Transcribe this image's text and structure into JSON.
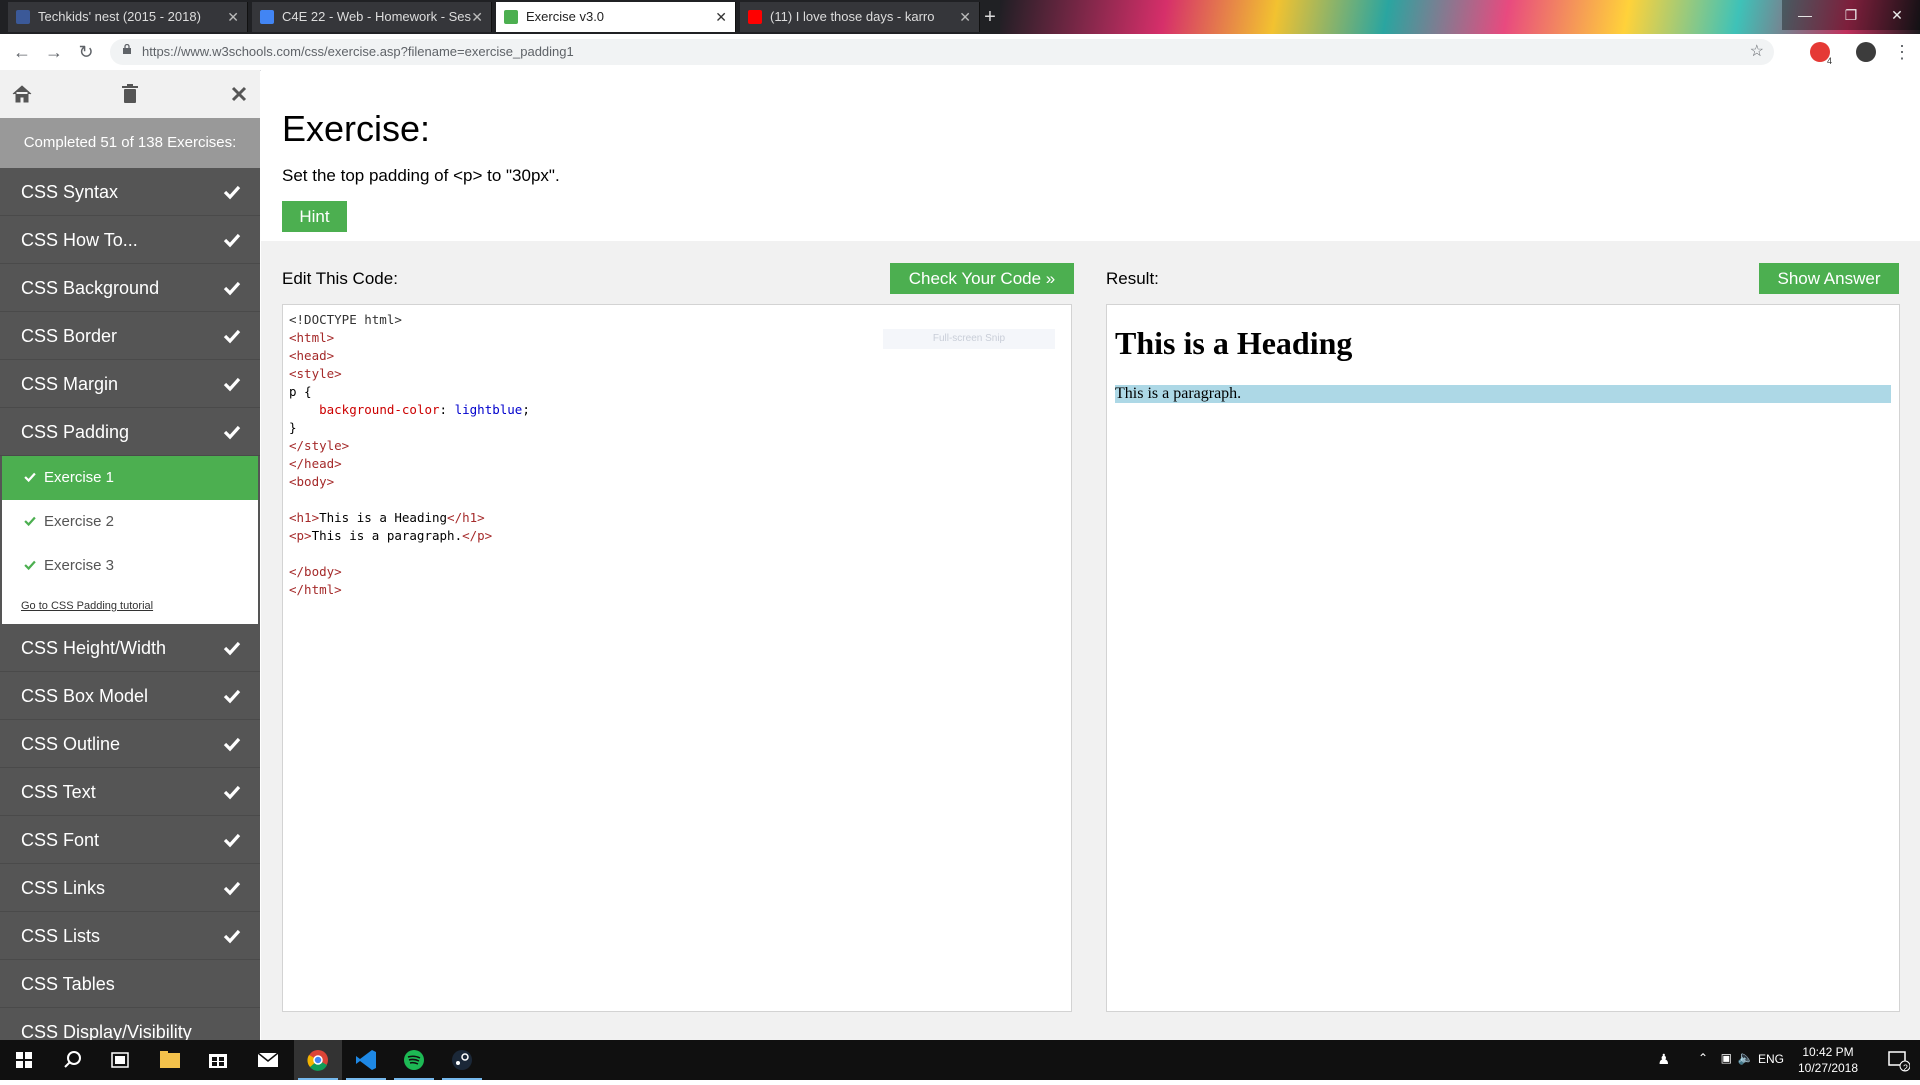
{
  "browser": {
    "tabs": [
      {
        "label": "Techkids' nest (2015 - 2018)",
        "favicon_color": "#3b5998",
        "active": false
      },
      {
        "label": "C4E 22 - Web - Homework - Ses",
        "favicon_color": "#4285f4",
        "active": false
      },
      {
        "label": "Exercise v3.0",
        "favicon_color": "#4CAF50",
        "active": true
      },
      {
        "label": "(11) I love those days - karro",
        "favicon_color": "#ff0000",
        "active": false
      }
    ],
    "new_tab": "+",
    "url": "https://www.w3schools.com/css/exercise.asp?filename=exercise_padding1",
    "window_controls": [
      "—",
      "❐",
      "✕"
    ],
    "extension_badge": "4"
  },
  "sidebar": {
    "progress": "Completed 51 of 138 Exercises:",
    "items_before": [
      {
        "label": "CSS Syntax",
        "done": true
      },
      {
        "label": "CSS How To...",
        "done": true
      },
      {
        "label": "CSS Background",
        "done": true
      },
      {
        "label": "CSS Border",
        "done": true
      },
      {
        "label": "CSS Margin",
        "done": true
      },
      {
        "label": "CSS Padding",
        "done": true
      }
    ],
    "exercises": [
      {
        "label": "Exercise 1",
        "active": true
      },
      {
        "label": "Exercise 2",
        "active": false
      },
      {
        "label": "Exercise 3",
        "active": false
      }
    ],
    "tutorial_link": "Go to CSS Padding tutorial",
    "items_after": [
      {
        "label": "CSS Height/Width",
        "done": true
      },
      {
        "label": "CSS Box Model",
        "done": true
      },
      {
        "label": "CSS Outline",
        "done": true
      },
      {
        "label": "CSS Text",
        "done": true
      },
      {
        "label": "CSS Font",
        "done": true
      },
      {
        "label": "CSS Links",
        "done": true
      },
      {
        "label": "CSS Lists",
        "done": true
      },
      {
        "label": "CSS Tables",
        "done": false
      },
      {
        "label": "CSS Display/Visibility",
        "done": false
      }
    ]
  },
  "exercise": {
    "title": "Exercise:",
    "description": "Set the top padding of <p> to \"30px\".",
    "hint": "Hint",
    "edit_label": "Edit This Code:",
    "check_button": "Check Your Code »",
    "result_label": "Result:",
    "answer_button": "Show Answer",
    "snip_overlay": "Full-screen Snip",
    "code": [
      "<!DOCTYPE html>",
      "<html>",
      "<head>",
      "<style>",
      "p {",
      "    background-color: lightblue;",
      "}",
      "</style>",
      "</head>",
      "<body>",
      "",
      "<h1>This is a Heading</h1>",
      "<p>This is a paragraph.</p>",
      "",
      "</body>",
      "</html>"
    ],
    "result_heading": "This is a Heading",
    "result_paragraph": "This is a paragraph."
  },
  "taskbar": {
    "lang": "ENG",
    "time": "10:42 PM",
    "date": "10/27/2018",
    "notification_count": "2"
  },
  "colors": {
    "accent_green": "#4CAF50",
    "sidebar_bg": "#555555",
    "paragraph_bg": "#add8e6"
  }
}
